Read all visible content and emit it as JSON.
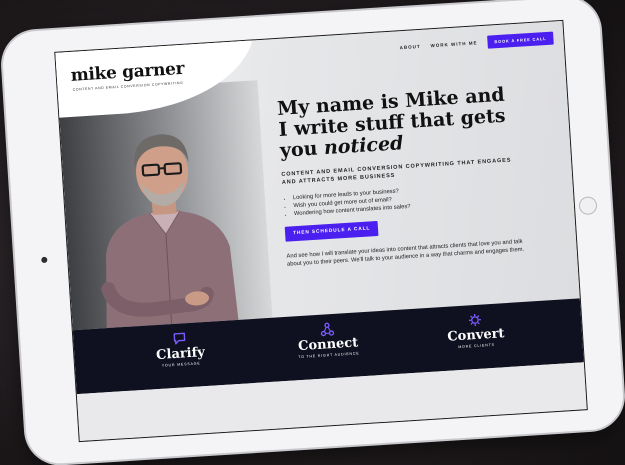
{
  "site": {
    "logo": "mike garner",
    "tagline": "CONTENT AND EMAIL CONVERSION COPYWRITING"
  },
  "nav": {
    "about": "ABOUT",
    "work_with_me": "WORK WITH ME",
    "cta": "BOOK A FREE CALL"
  },
  "hero": {
    "headline_line1": "My name is Mike and",
    "headline_line2": "I write stuff that gets",
    "headline_line3_prefix": "you ",
    "headline_line3_em": "noticed",
    "subhead": "CONTENT AND EMAIL CONVERSION COPYWRITING THAT ENGAGES AND ATTRACTS MORE BUSINESS",
    "bullets": [
      "Looking for more leads to your business?",
      "Wish you could get more out of email?",
      "Wondering how content translates into sales?"
    ],
    "cta": "THEN SCHEDULE A CALL",
    "paragraph": "And see how I will translate your ideas into content that attracts clients that love you and talk about you to their peers. We'll talk to your audience in a way that charms and engages them."
  },
  "pillars": [
    {
      "icon": "chat-bubble-icon",
      "title": "Clarify",
      "sub": "YOUR MESSAGE"
    },
    {
      "icon": "network-icon",
      "title": "Connect",
      "sub": "TO THE RIGHT AUDIENCE"
    },
    {
      "icon": "gear-icon",
      "title": "Convert",
      "sub": "MORE CLIENTS"
    }
  ],
  "colors": {
    "accent": "#4a1ff0",
    "band": "#0f1020"
  }
}
